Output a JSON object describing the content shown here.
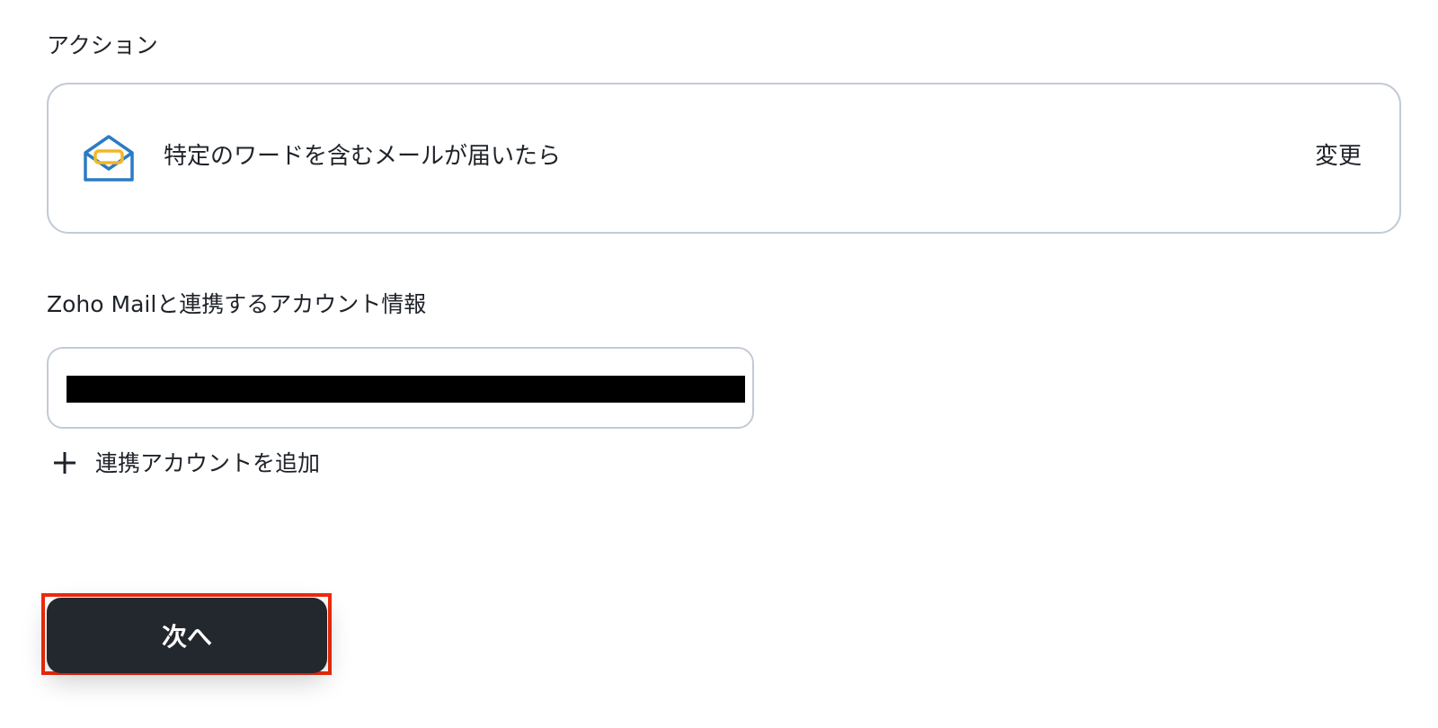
{
  "action_section": {
    "label": "アクション",
    "card": {
      "icon": "zoho-mail-envelope-icon",
      "title": "特定のワードを含むメールが届いたら",
      "change_label": "変更"
    }
  },
  "account_section": {
    "label": "Zoho Mailと連携するアカウント情報",
    "selected_value": "",
    "add_account_label": "連携アカウントを追加"
  },
  "footer": {
    "next_label": "次へ"
  },
  "colors": {
    "button_bg": "#23272e",
    "border": "#c3cad6",
    "highlight": "#ee2b0d",
    "icon_blue": "#2b7bc4",
    "icon_yellow": "#f2b724"
  }
}
